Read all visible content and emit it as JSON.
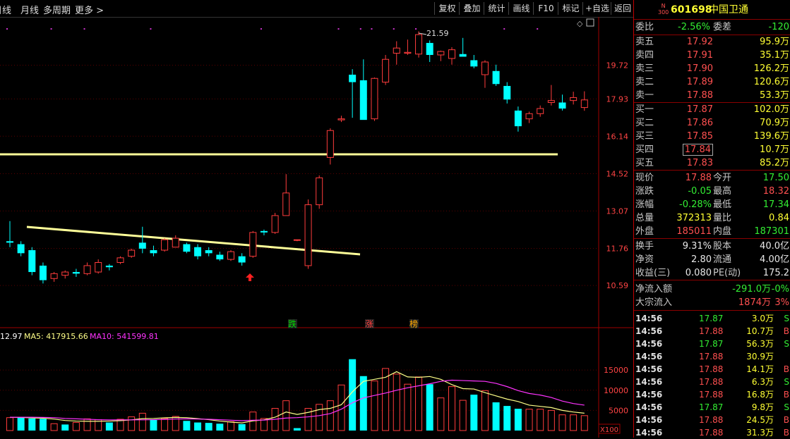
{
  "toolbar": {
    "left_items": [
      "日线",
      "月线",
      "多周期",
      "更多"
    ],
    "right_items": [
      "复权",
      "叠加",
      "统计",
      "画线",
      "F10",
      "标记",
      "+自选",
      "返回"
    ]
  },
  "stock": {
    "badge_top": "N",
    "badge_bottom": "300",
    "code": "601698",
    "name": "中国卫通"
  },
  "order_book": {
    "webi_label": "委比",
    "webi_value": "-2.56%",
    "weicha_label": "委差",
    "weicha_value": "-120",
    "sell": [
      {
        "label": "卖五",
        "price": "17.92",
        "vol": "95.9万"
      },
      {
        "label": "卖四",
        "price": "17.91",
        "vol": "35.1万"
      },
      {
        "label": "卖三",
        "price": "17.90",
        "vol": "126.2万"
      },
      {
        "label": "卖二",
        "price": "17.89",
        "vol": "120.6万"
      },
      {
        "label": "卖一",
        "price": "17.88",
        "vol": "53.3万"
      }
    ],
    "buy": [
      {
        "label": "买一",
        "price": "17.87",
        "vol": "102.0万"
      },
      {
        "label": "买二",
        "price": "17.86",
        "vol": "70.9万"
      },
      {
        "label": "买三",
        "price": "17.85",
        "vol": "139.6万"
      },
      {
        "label": "买四",
        "price": "17.84",
        "vol": "10.7万"
      },
      {
        "label": "买五",
        "price": "17.83",
        "vol": "85.2万"
      }
    ]
  },
  "quote": [
    {
      "l1": "现价",
      "v1": "17.88",
      "c1": "red",
      "l2": "今开",
      "v2": "17.50",
      "c2": "green"
    },
    {
      "l1": "涨跌",
      "v1": "-0.05",
      "c1": "green",
      "l2": "最高",
      "v2": "18.32",
      "c2": "red"
    },
    {
      "l1": "涨幅",
      "v1": "-0.28%",
      "c1": "green",
      "l2": "最低",
      "v2": "17.34",
      "c2": "green"
    },
    {
      "l1": "总量",
      "v1": "372313",
      "c1": "yellow",
      "l2": "量比",
      "v2": "0.84",
      "c2": "yellow"
    },
    {
      "l1": "外盘",
      "v1": "185011",
      "c1": "red",
      "l2": "内盘",
      "v2": "187301",
      "c2": "green"
    }
  ],
  "fundamentals": [
    {
      "l1": "换手",
      "v1": "9.31%",
      "l2": "股本",
      "v2": "40.0亿"
    },
    {
      "l1": "净资",
      "v1": "2.80",
      "l2": "流通",
      "v2": "4.00亿"
    },
    {
      "l1": "收益(三)",
      "v1": "0.080",
      "l2": "PE(动)",
      "v2": "175.2"
    }
  ],
  "flow": [
    {
      "label": "净流入额",
      "value": "-291.0万",
      "pct": "-0%",
      "color": "green"
    },
    {
      "label": "大宗流入",
      "value": "1874万",
      "pct": "3%",
      "color": "red"
    }
  ],
  "ticks": [
    {
      "time": "14:56",
      "price": "17.87",
      "vol": "3.0万",
      "side": "S"
    },
    {
      "time": "14:56",
      "price": "17.88",
      "vol": "10.7万",
      "side": "B"
    },
    {
      "time": "14:56",
      "price": "17.87",
      "vol": "56.3万",
      "side": "S"
    },
    {
      "time": "14:56",
      "price": "17.88",
      "vol": "30.9万",
      "side": ""
    },
    {
      "time": "14:56",
      "price": "17.88",
      "vol": "14.1万",
      "side": "B"
    },
    {
      "time": "14:56",
      "price": "17.88",
      "vol": "6.3万",
      "side": "S"
    },
    {
      "time": "14:56",
      "price": "17.88",
      "vol": "16.8万",
      "side": "B"
    },
    {
      "time": "14:56",
      "price": "17.87",
      "vol": "9.8万",
      "side": "S"
    },
    {
      "time": "14:56",
      "price": "17.88",
      "vol": "24.5万",
      "side": "B"
    },
    {
      "time": "14:56",
      "price": "17.88",
      "vol": "31.3万",
      "side": "B"
    }
  ],
  "colors": {
    "up": "#ff3c3c",
    "down": "#00ffff",
    "ma5": "#ffff88",
    "ma10": "#ff33ff",
    "trend": "#ffff99"
  },
  "chart_data": {
    "type": "candlestick",
    "price_ticks": [
      "19.72",
      "17.93",
      "16.14",
      "14.52",
      "13.07",
      "11.76",
      "10.59"
    ],
    "high_annotation": "21.59",
    "signal_labels": [
      "跌",
      "涨",
      "榜"
    ],
    "volume_ticks": [
      "15000",
      "10000",
      "5000"
    ],
    "volume_unit": "X100",
    "volume_legend": [
      {
        "text": "12.97",
        "color": "#ffffff"
      },
      {
        "text": "MA5: 417915.66",
        "color": "#ffff88"
      },
      {
        "text": "MA10: 541599.81",
        "color": "#ff33ff"
      }
    ],
    "candles": [
      {
        "o": 12.0,
        "h": 12.7,
        "l": 11.8,
        "c": 11.95
      },
      {
        "o": 11.9,
        "h": 12.0,
        "l": 11.5,
        "c": 11.6
      },
      {
        "o": 11.7,
        "h": 11.8,
        "l": 10.9,
        "c": 11.0
      },
      {
        "o": 11.2,
        "h": 11.3,
        "l": 10.65,
        "c": 10.75
      },
      {
        "o": 10.8,
        "h": 11.0,
        "l": 10.7,
        "c": 10.95
      },
      {
        "o": 10.9,
        "h": 11.05,
        "l": 10.8,
        "c": 11.0
      },
      {
        "o": 11.0,
        "h": 11.1,
        "l": 10.85,
        "c": 10.95
      },
      {
        "o": 10.95,
        "h": 11.3,
        "l": 10.9,
        "c": 11.2
      },
      {
        "o": 11.0,
        "h": 11.4,
        "l": 10.95,
        "c": 11.3
      },
      {
        "o": 11.2,
        "h": 11.25,
        "l": 11.05,
        "c": 11.15
      },
      {
        "o": 11.3,
        "h": 11.5,
        "l": 11.25,
        "c": 11.45
      },
      {
        "o": 11.5,
        "h": 11.75,
        "l": 11.45,
        "c": 11.7
      },
      {
        "o": 11.95,
        "h": 12.5,
        "l": 11.6,
        "c": 11.75
      },
      {
        "o": 11.7,
        "h": 11.85,
        "l": 11.5,
        "c": 11.6
      },
      {
        "o": 11.7,
        "h": 12.1,
        "l": 11.65,
        "c": 12.05
      },
      {
        "o": 11.8,
        "h": 12.2,
        "l": 11.8,
        "c": 12.1
      },
      {
        "o": 11.9,
        "h": 11.95,
        "l": 11.6,
        "c": 11.65
      },
      {
        "o": 11.8,
        "h": 11.9,
        "l": 11.4,
        "c": 11.5
      },
      {
        "o": 11.7,
        "h": 11.8,
        "l": 11.5,
        "c": 11.6
      },
      {
        "o": 11.55,
        "h": 11.65,
        "l": 11.35,
        "c": 11.4
      },
      {
        "o": 11.4,
        "h": 11.7,
        "l": 11.35,
        "c": 11.65
      },
      {
        "o": 11.5,
        "h": 11.6,
        "l": 11.2,
        "c": 11.3
      },
      {
        "o": 11.5,
        "h": 12.35,
        "l": 11.45,
        "c": 12.3
      },
      {
        "o": 12.35,
        "h": 12.4,
        "l": 12.2,
        "c": 12.3
      },
      {
        "o": 12.3,
        "h": 13.0,
        "l": 12.25,
        "c": 12.9
      },
      {
        "o": 12.9,
        "h": 14.5,
        "l": 12.9,
        "c": 13.75
      },
      {
        "o": 12.05,
        "h": 12.05,
        "l": 12.0,
        "c": 12.05
      },
      {
        "o": 11.2,
        "h": 13.5,
        "l": 11.1,
        "c": 13.3
      },
      {
        "o": 13.3,
        "h": 14.45,
        "l": 13.15,
        "c": 14.35
      },
      {
        "o": 15.2,
        "h": 16.5,
        "l": 14.9,
        "c": 16.4
      },
      {
        "o": 16.9,
        "h": 17.1,
        "l": 16.8,
        "c": 16.95
      },
      {
        "o": 19.2,
        "h": 19.5,
        "l": 17.0,
        "c": 18.8
      },
      {
        "o": 18.9,
        "h": 20.05,
        "l": 16.95,
        "c": 16.9
      },
      {
        "o": 16.95,
        "h": 19.05,
        "l": 16.85,
        "c": 19.0
      },
      {
        "o": 18.8,
        "h": 20.3,
        "l": 18.65,
        "c": 20.05
      },
      {
        "o": 20.4,
        "h": 21.1,
        "l": 19.75,
        "c": 20.7
      },
      {
        "o": 20.4,
        "h": 21.2,
        "l": 20.3,
        "c": 20.45
      },
      {
        "o": 20.35,
        "h": 21.7,
        "l": 20.15,
        "c": 21.5
      },
      {
        "o": 21.0,
        "h": 21.15,
        "l": 19.9,
        "c": 20.3
      },
      {
        "o": 20.3,
        "h": 20.55,
        "l": 19.95,
        "c": 20.5
      },
      {
        "o": 20.1,
        "h": 20.75,
        "l": 19.75,
        "c": 20.6
      },
      {
        "o": 20.35,
        "h": 21.3,
        "l": 20.3,
        "c": 20.2
      },
      {
        "o": 20.0,
        "h": 20.3,
        "l": 19.55,
        "c": 19.65
      },
      {
        "o": 19.2,
        "h": 20.0,
        "l": 18.5,
        "c": 19.9
      },
      {
        "o": 19.4,
        "h": 19.75,
        "l": 18.6,
        "c": 18.7
      },
      {
        "o": 18.6,
        "h": 18.8,
        "l": 17.7,
        "c": 17.9
      },
      {
        "o": 17.35,
        "h": 17.55,
        "l": 16.35,
        "c": 16.6
      },
      {
        "o": 16.95,
        "h": 17.3,
        "l": 16.75,
        "c": 17.2
      },
      {
        "o": 17.2,
        "h": 17.6,
        "l": 17.05,
        "c": 17.45
      },
      {
        "o": 17.75,
        "h": 18.65,
        "l": 17.6,
        "c": 17.85
      },
      {
        "o": 17.75,
        "h": 18.15,
        "l": 17.35,
        "c": 17.45
      },
      {
        "o": 17.85,
        "h": 18.3,
        "l": 17.65,
        "c": 18.0
      },
      {
        "o": 17.5,
        "h": 18.32,
        "l": 17.34,
        "c": 17.88
      }
    ],
    "volumes": [
      {
        "v": 3200,
        "up": true
      },
      {
        "v": 3400,
        "up": false
      },
      {
        "v": 3000,
        "up": false
      },
      {
        "v": 2900,
        "up": false
      },
      {
        "v": 1700,
        "up": true
      },
      {
        "v": 1500,
        "up": false
      },
      {
        "v": 2000,
        "up": true
      },
      {
        "v": 2900,
        "up": true
      },
      {
        "v": 2700,
        "up": true
      },
      {
        "v": 2000,
        "up": false
      },
      {
        "v": 2800,
        "up": true
      },
      {
        "v": 3400,
        "up": true
      },
      {
        "v": 4300,
        "up": true
      },
      {
        "v": 2800,
        "up": false
      },
      {
        "v": 3000,
        "up": true
      },
      {
        "v": 3500,
        "up": true
      },
      {
        "v": 2400,
        "up": false
      },
      {
        "v": 2000,
        "up": false
      },
      {
        "v": 1900,
        "up": false
      },
      {
        "v": 1700,
        "up": false
      },
      {
        "v": 2200,
        "up": true
      },
      {
        "v": 1600,
        "up": false
      },
      {
        "v": 4600,
        "up": true
      },
      {
        "v": 3000,
        "up": true
      },
      {
        "v": 5500,
        "up": true
      },
      {
        "v": 7400,
        "up": true
      },
      {
        "v": 600,
        "up": false
      },
      {
        "v": 5500,
        "up": true
      },
      {
        "v": 6500,
        "up": true
      },
      {
        "v": 7400,
        "up": true
      },
      {
        "v": 11300,
        "up": true
      },
      {
        "v": 17700,
        "up": false
      },
      {
        "v": 13500,
        "up": false
      },
      {
        "v": 12300,
        "up": true
      },
      {
        "v": 15400,
        "up": true
      },
      {
        "v": 14000,
        "up": true
      },
      {
        "v": 11500,
        "up": true
      },
      {
        "v": 13300,
        "up": true
      },
      {
        "v": 11500,
        "up": false
      },
      {
        "v": 8100,
        "up": true
      },
      {
        "v": 10900,
        "up": true
      },
      {
        "v": 7500,
        "up": true
      },
      {
        "v": 8900,
        "up": false
      },
      {
        "v": 9900,
        "up": true
      },
      {
        "v": 7000,
        "up": false
      },
      {
        "v": 6100,
        "up": false
      },
      {
        "v": 5400,
        "up": false
      },
      {
        "v": 5300,
        "up": true
      },
      {
        "v": 5300,
        "up": true
      },
      {
        "v": 5000,
        "up": true
      },
      {
        "v": 3900,
        "up": true
      },
      {
        "v": 3900,
        "up": true
      },
      {
        "v": 3700,
        "up": true
      }
    ],
    "ma5": [
      3300,
      3250,
      3150,
      3050,
      2850,
      2500,
      2350,
      2300,
      2300,
      2350,
      2450,
      2650,
      2950,
      3000,
      3150,
      3250,
      3200,
      2950,
      2700,
      2350,
      2100,
      1900,
      2400,
      2650,
      3300,
      4600,
      4000,
      4500,
      5200,
      5500,
      6400,
      9600,
      12200,
      12700,
      13200,
      14600,
      13300,
      13200,
      13400,
      12700,
      11400,
      10400,
      10300,
      9400,
      8600,
      7800,
      7200,
      6300,
      6000,
      5700,
      5000,
      4600,
      4300
    ],
    "ma10": [
      3300,
      3300,
      3300,
      3250,
      3200,
      3000,
      2900,
      2800,
      2700,
      2650,
      2650,
      2650,
      2650,
      2700,
      2750,
      2850,
      2900,
      2850,
      2800,
      2700,
      2550,
      2450,
      2550,
      2600,
      2800,
      3100,
      3200,
      3400,
      3700,
      4200,
      5300,
      6900,
      8100,
      8700,
      9300,
      10000,
      10600,
      11100,
      11600,
      12200,
      12500,
      12400,
      12300,
      12200,
      11700,
      10900,
      9900,
      9200,
      8800,
      8200,
      7300,
      6700,
      6300
    ]
  }
}
